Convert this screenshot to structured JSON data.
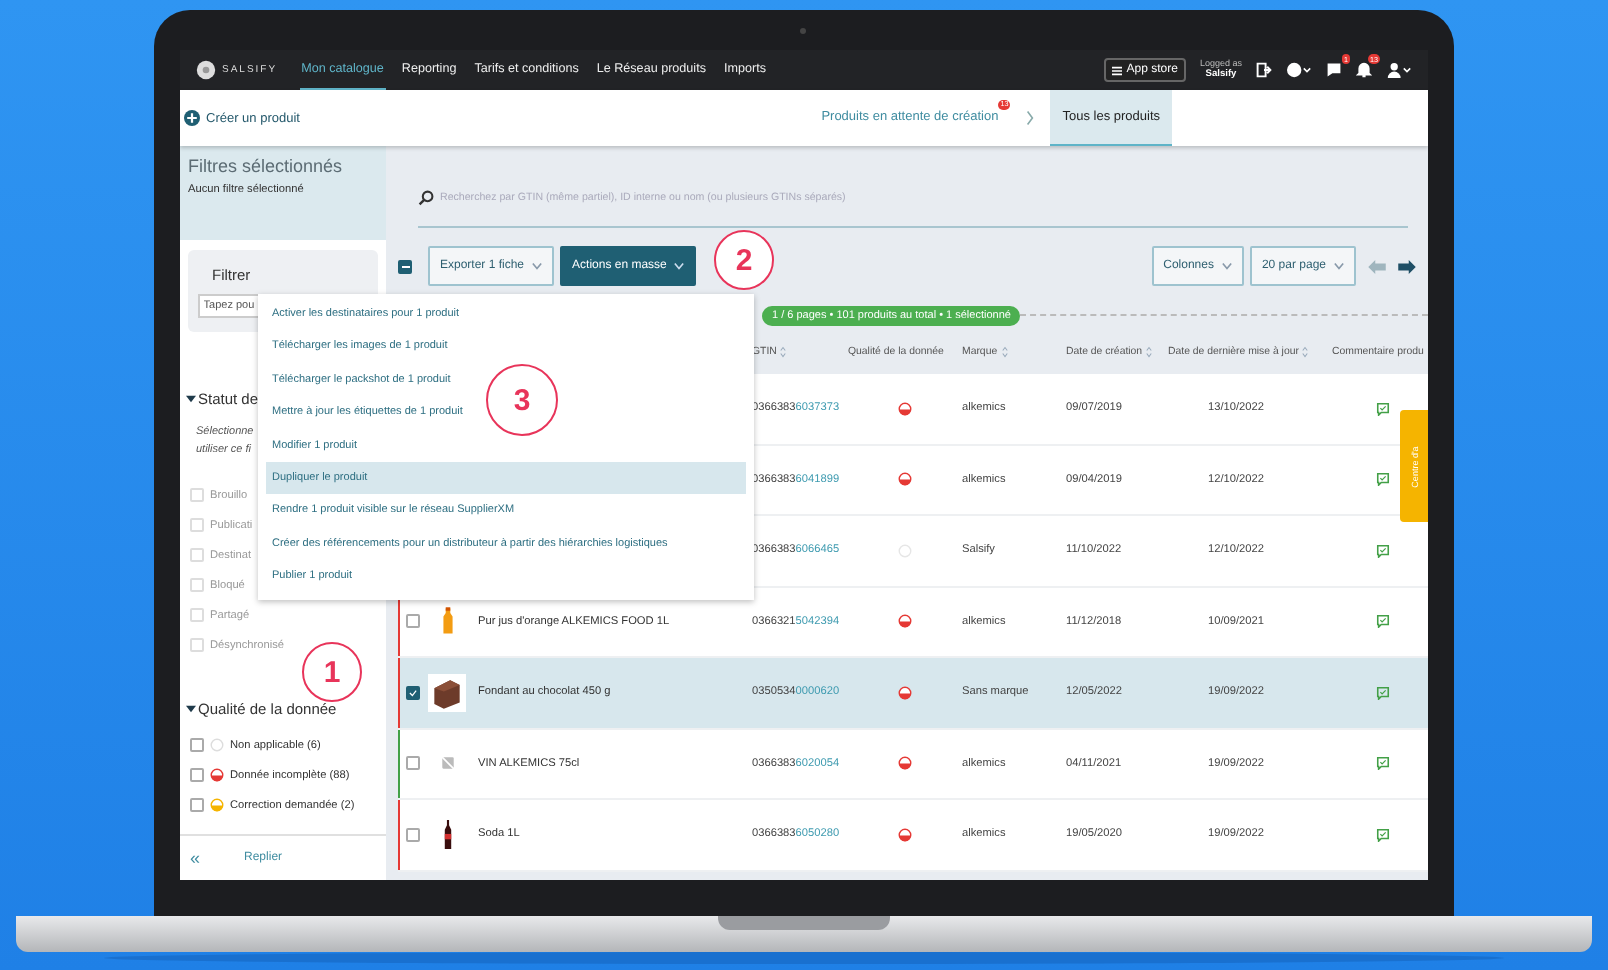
{
  "nav": {
    "logo": "SALSIFY",
    "tabs": [
      {
        "label": "Mon catalogue",
        "selected": true
      },
      {
        "label": "Reporting",
        "selected": false
      },
      {
        "label": "Tarifs et conditions",
        "selected": false
      },
      {
        "label": "Le Réseau produits",
        "selected": false
      },
      {
        "label": "Imports",
        "selected": false
      }
    ],
    "app_store": "App store",
    "logged_as": "Logged as",
    "user": "Salsify",
    "messages_badge": "1",
    "notifications_badge": "13"
  },
  "subbar": {
    "create": "Créer un produit",
    "tabs": [
      {
        "label": "Produits en attente de création",
        "badge": "13",
        "selected": false
      },
      {
        "label": "Tous les produits",
        "selected": true
      }
    ]
  },
  "sidebar": {
    "title": "Filtres sélectionnés",
    "subtitle": "Aucun filtre sélectionné",
    "filter_title": "Filtrer",
    "filter_placeholder": "Tapez pou",
    "sections": [
      {
        "title": "Statut de",
        "expanded": true,
        "hint": "Sélectionne utiliser ce fi",
        "options": [
          {
            "label": "Brouillo",
            "checked": false,
            "disabled": true
          },
          {
            "label": "Publicati",
            "checked": false,
            "disabled": true
          },
          {
            "label": "Destinat",
            "checked": false,
            "disabled": true
          },
          {
            "label": "Bloqué",
            "checked": false,
            "disabled": true
          },
          {
            "label": "Partagé",
            "checked": false,
            "disabled": true
          },
          {
            "label": "Désynchronisé",
            "checked": false,
            "disabled": true
          }
        ]
      },
      {
        "title": "Qualité de la donnée",
        "expanded": true,
        "options": [
          {
            "label": "Non applicable (6)",
            "checked": false,
            "disabled": false,
            "kind": "not_applicable"
          },
          {
            "label": "Donnée incomplète (88)",
            "checked": false,
            "disabled": false,
            "kind": "incomplete"
          },
          {
            "label": "Correction demandée (2)",
            "checked": false,
            "disabled": false,
            "kind": "correction"
          }
        ]
      }
    ],
    "collapse_icon": "«",
    "collapse": "Replier"
  },
  "main": {
    "search_placeholder": "Recherchez par GTIN (même partiel), ID interne ou nom (ou plusieurs GTINs séparés)",
    "select_all": {
      "indeterminate": true
    },
    "export": "Exporter 1 fiche",
    "actions": "Actions en masse",
    "columns_button": "Colonnes",
    "per_page": "20 par page",
    "prev_disabled": true,
    "next_disabled": false,
    "summary": "1 / 6 pages • 101 produits au total • 1 sélectionné",
    "columns": [
      {
        "label": "GTIN",
        "sortable": true
      },
      {
        "label": "Qualité de la donnée",
        "sortable": false
      },
      {
        "label": "Marque",
        "sortable": true
      },
      {
        "label": "Date de création",
        "sortable": true
      },
      {
        "label": "Date de dernière mise à jour",
        "sortable": true
      },
      {
        "label": "Commentaire produ",
        "sortable": false
      }
    ],
    "rows": [
      {
        "gtin": {
          "prefix": "0366383",
          "link": "6037373"
        },
        "quality": {
          "kind": "incomplete"
        },
        "brand": "alkemics",
        "created": "09/07/2019",
        "updated": "13/10/2022",
        "selected": false
      },
      {
        "gtin": {
          "prefix": "0366383",
          "link": "6041899"
        },
        "quality": {
          "kind": "incomplete"
        },
        "brand": "alkemics",
        "created": "09/04/2019",
        "updated": "12/10/2022",
        "selected": false
      },
      {
        "gtin": {
          "prefix": "0366383",
          "link": "6066465"
        },
        "quality": {
          "kind": "not_applicable"
        },
        "brand": "Salsify",
        "created": "11/10/2022",
        "updated": "12/10/2022",
        "selected": false
      },
      {
        "checked": false,
        "kind": "juice",
        "name": "Pur jus d'orange ALKEMICS FOOD 1L",
        "gtin": {
          "prefix": "0366321",
          "link": "5042394"
        },
        "quality": {
          "kind": "incomplete"
        },
        "brand": "alkemics",
        "created": "11/12/2018",
        "updated": "10/09/2021",
        "color": "#e53935",
        "selected": false
      },
      {
        "checked": true,
        "kind": "cake",
        "name": "Fondant au chocolat 450 g",
        "gtin": {
          "prefix": "0350534",
          "link": "0000620"
        },
        "quality": {
          "kind": "incomplete"
        },
        "brand": "Sans marque",
        "created": "12/05/2022",
        "updated": "19/09/2022",
        "color": "#e53935",
        "selected": true
      },
      {
        "checked": false,
        "kind": "placeholder",
        "name": "VIN ALKEMICS 75cl",
        "gtin": {
          "prefix": "0366383",
          "link": "6020054"
        },
        "quality": {
          "kind": "incomplete"
        },
        "brand": "alkemics",
        "created": "04/11/2021",
        "updated": "19/09/2022",
        "color": "#43a047",
        "selected": false
      },
      {
        "checked": false,
        "kind": "soda",
        "name": "Soda 1L",
        "gtin": {
          "prefix": "0366383",
          "link": "6050280"
        },
        "quality": {
          "kind": "incomplete"
        },
        "brand": "alkemics",
        "created": "19/05/2020",
        "updated": "19/09/2022",
        "color": "#e53935",
        "selected": false
      }
    ]
  },
  "menu": [
    {
      "label": "Activer les destinataires pour 1 produit",
      "selected": false
    },
    {
      "label": "Télécharger les images de 1 produit",
      "selected": false
    },
    {
      "label": "Télécharger le packshot de 1 produit",
      "selected": false
    },
    {
      "label": "Mettre à jour les étiquettes de 1 produit",
      "selected": false
    },
    {
      "label": "Modifier 1 produit",
      "selected": false
    },
    {
      "label": "Dupliquer le produit",
      "selected": true
    },
    {
      "label": "Rendre 1 produit visible sur le réseau SupplierXM",
      "selected": false
    },
    {
      "label": "Créer des référencements pour un distributeur à partir des hiérarchies logistiques",
      "selected": false
    },
    {
      "label": "Publier 1 produit",
      "selected": false
    }
  ],
  "annotations": [
    "1",
    "2",
    "3"
  ],
  "help_tab": "Centre d'a"
}
